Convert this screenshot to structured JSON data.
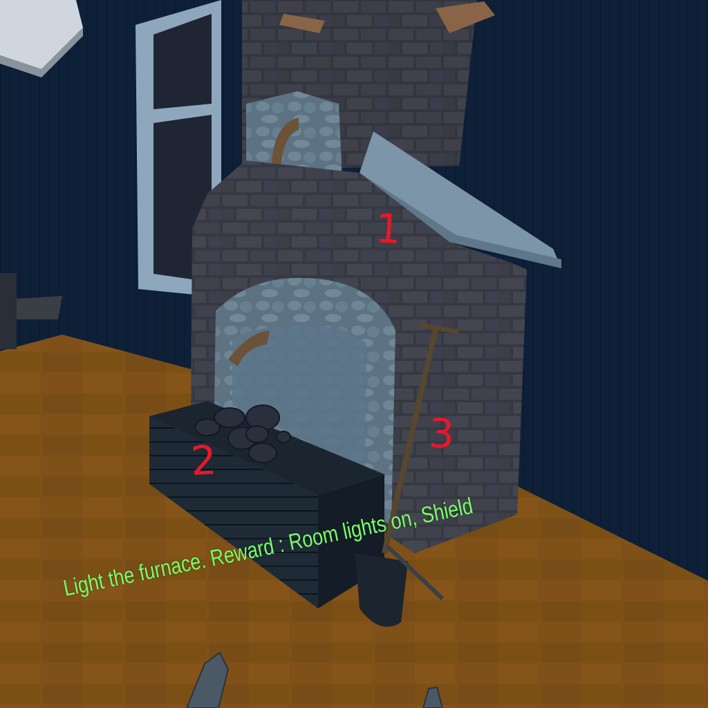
{
  "quest": {
    "text": "Light the furnace. Reward : Room lights on, Shield",
    "color": "#7cfc6a"
  },
  "annotations": {
    "marker_1": "1",
    "marker_2": "2",
    "marker_3": "3",
    "color": "#e8182a"
  },
  "scene": {
    "objects": [
      "brick-furnace",
      "coal-crate",
      "shovel",
      "window",
      "wooden-floor",
      "wall-shelf",
      "player-hands"
    ]
  }
}
